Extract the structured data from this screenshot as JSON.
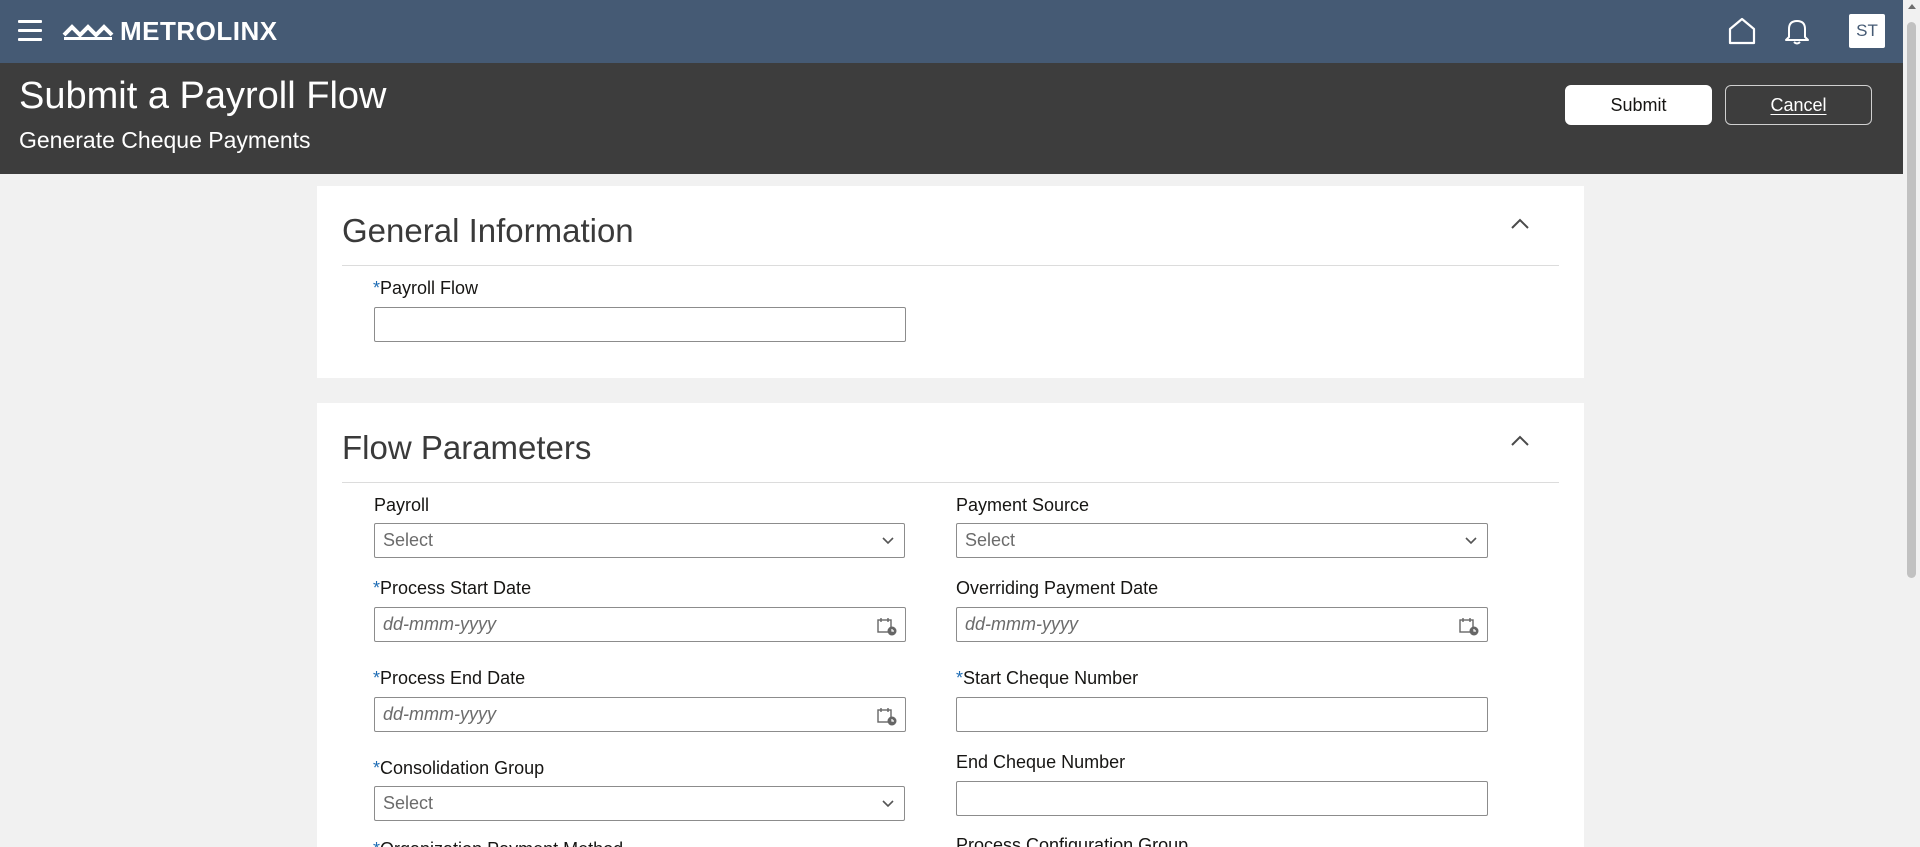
{
  "app": {
    "brand": "METROLINX",
    "avatar_initials": "ST",
    "icons": {
      "menu": "hamburger-icon",
      "home": "home-icon",
      "notifications": "bell-icon"
    },
    "colors": {
      "topbar": "#455a74",
      "header": "#3d3d3d",
      "required": "#1f6db5"
    }
  },
  "header": {
    "title": "Submit a Payroll Flow",
    "subtitle": "Generate Cheque Payments",
    "submit_label": "Submit",
    "cancel_label": "Cancel"
  },
  "general": {
    "title": "General Information",
    "payroll_flow": {
      "required": "*",
      "label": "Payroll Flow",
      "value": ""
    }
  },
  "flow_params": {
    "title": "Flow Parameters",
    "payroll": {
      "label": "Payroll",
      "value": "Select"
    },
    "payment_source": {
      "label": "Payment Source",
      "value": "Select"
    },
    "process_start_date": {
      "required": "*",
      "label": "Process Start Date",
      "placeholder": "dd-mmm-yyyy"
    },
    "overriding_payment_date": {
      "label": "Overriding Payment Date",
      "placeholder": "dd-mmm-yyyy"
    },
    "process_end_date": {
      "required": "*",
      "label": "Process End Date",
      "placeholder": "dd-mmm-yyyy"
    },
    "start_cheque_number": {
      "required": "*",
      "label": "Start Cheque Number",
      "value": ""
    },
    "consolidation_group": {
      "required": "*",
      "label": "Consolidation Group",
      "value": "Select"
    },
    "end_cheque_number": {
      "label": "End Cheque Number",
      "value": ""
    },
    "organization_payment_method": {
      "required": "*",
      "label": "Organization Payment Method"
    },
    "process_configuration_group": {
      "label": "Process Configuration Group"
    }
  }
}
